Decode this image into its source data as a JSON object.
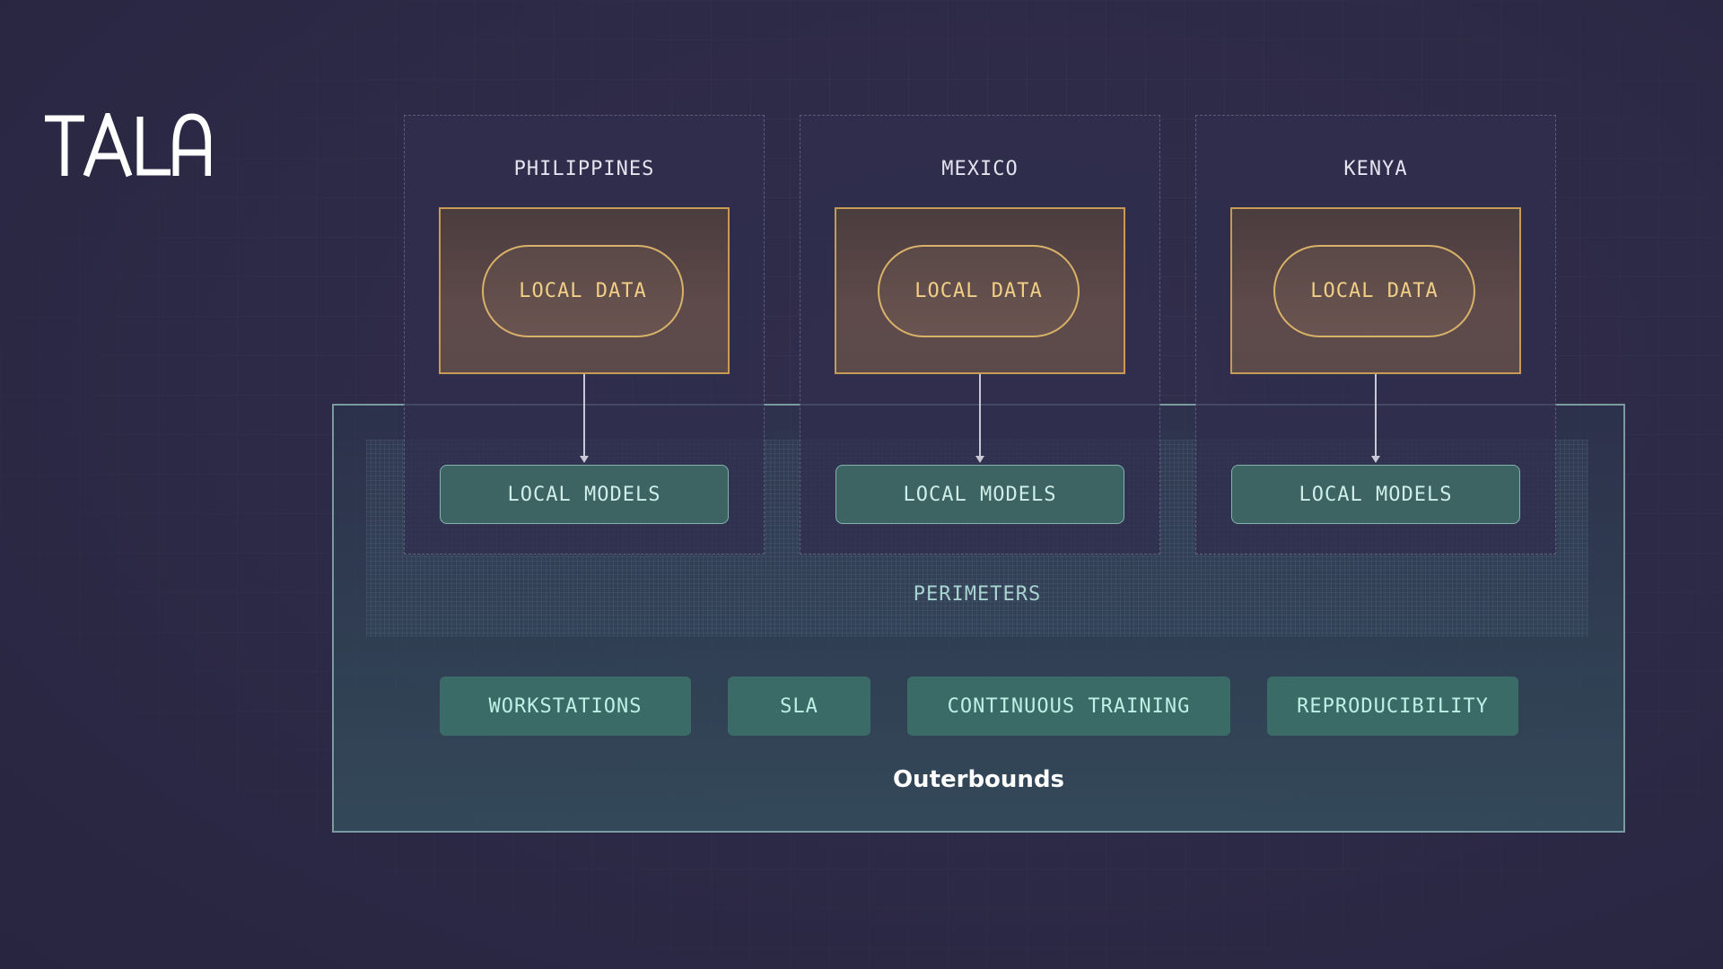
{
  "brand": {
    "logo_text": "TALA"
  },
  "regions": [
    {
      "name": "PHILIPPINES",
      "data_label": "LOCAL DATA",
      "models_label": "LOCAL MODELS"
    },
    {
      "name": "MEXICO",
      "data_label": "LOCAL DATA",
      "models_label": "LOCAL MODELS"
    },
    {
      "name": "KENYA",
      "data_label": "LOCAL DATA",
      "models_label": "LOCAL MODELS"
    }
  ],
  "perimeters_label": "PERIMETERS",
  "features": [
    "WORKSTATIONS",
    "SLA",
    "CONTINUOUS TRAINING",
    "REPRODUCIBILITY"
  ],
  "platform_name": "Outerbounds",
  "colors": {
    "background": "#2d2a47",
    "data_border": "#c99a55",
    "data_text": "#f2cf86",
    "models_fill": "#3d6363",
    "feature_fill": "#3b6b66",
    "platform_border": "#7a9ba0"
  }
}
